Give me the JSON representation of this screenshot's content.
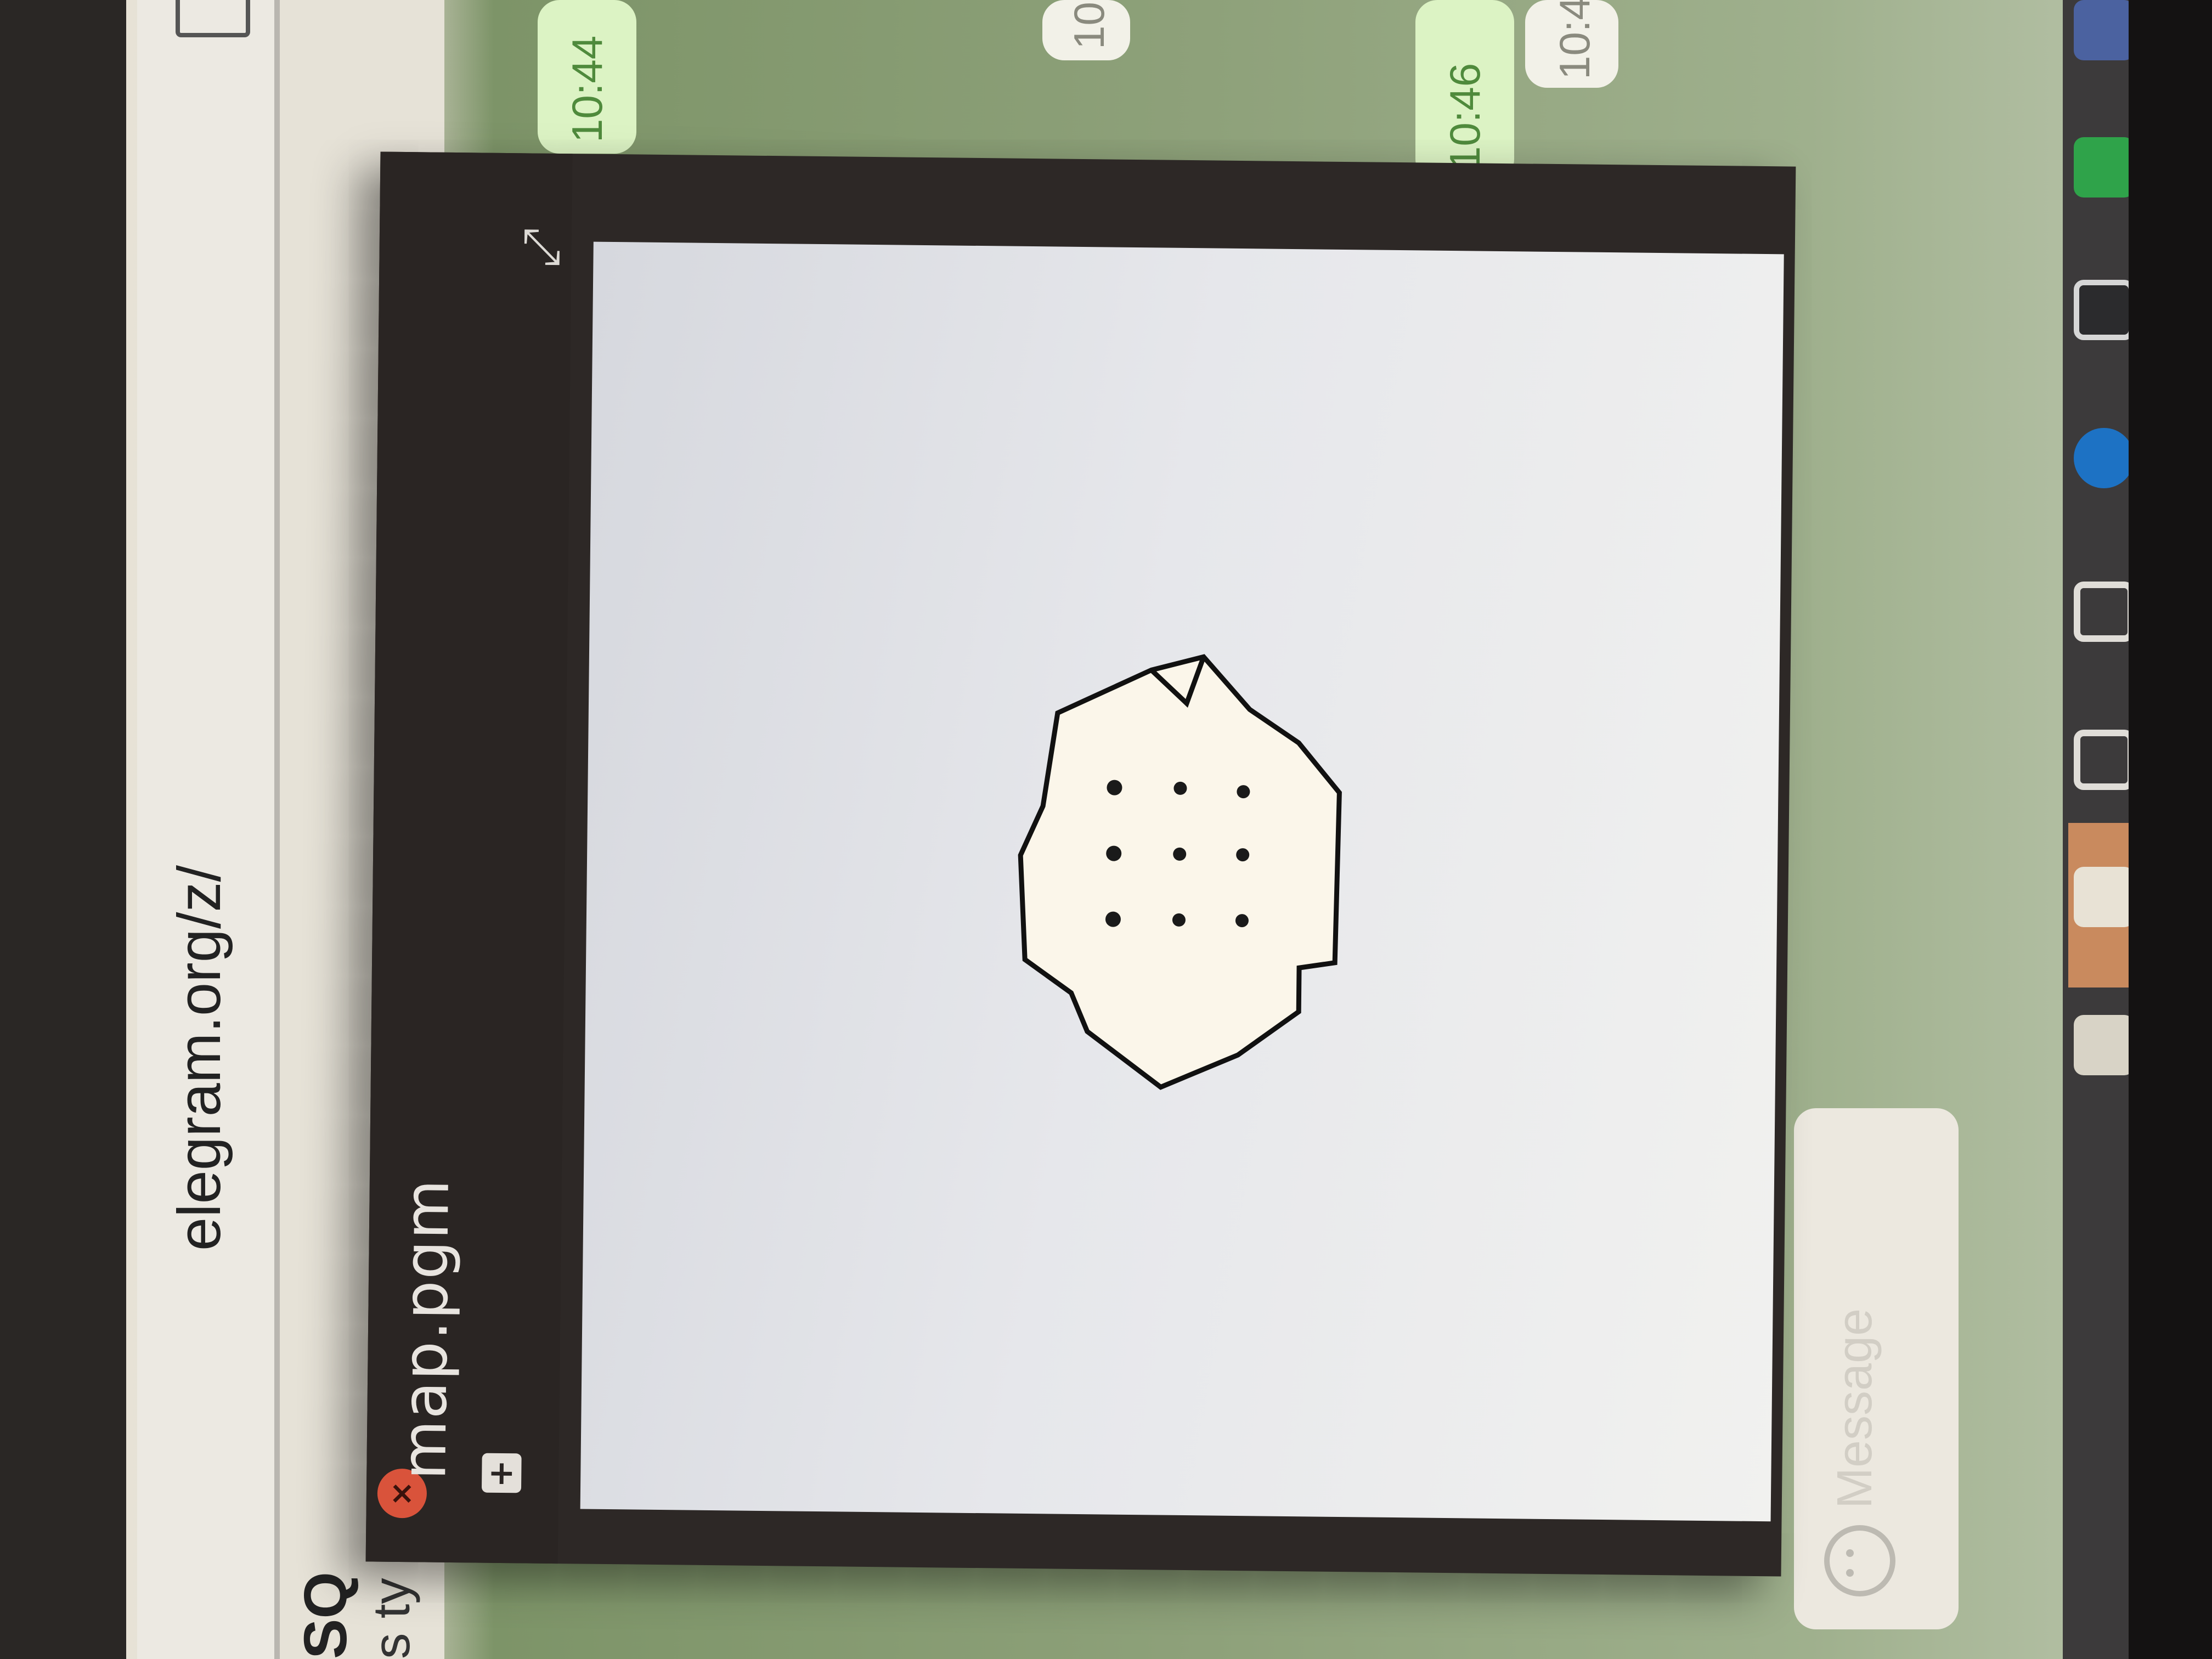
{
  "browser": {
    "address": "elegram.org/z/"
  },
  "chat": {
    "name": "SQ",
    "status": "s ty",
    "messages": [
      {
        "direction": "out",
        "time": "10:44"
      },
      {
        "direction": "out",
        "time": "10:46"
      },
      {
        "direction": "in",
        "time": "10"
      },
      {
        "direction": "in",
        "time": "10:4"
      }
    ],
    "composer_placeholder": "Message"
  },
  "viewer": {
    "title": "map.pgm",
    "close_label": "×",
    "add_label": "+",
    "fullscreen_label": "⤡"
  },
  "colors": {
    "viewer_bg": "#2d2826",
    "close_button": "#d9533b",
    "map_free_space": "#fbf6ea",
    "map_obstacle": "#111111",
    "dock_highlight": "#c98a5e"
  },
  "dock": {
    "items": [
      "file-manager-icon",
      "folder-icon",
      "package-icon",
      "package-icon",
      "teamviewer-icon",
      "vscode-icon",
      "terminal-icon",
      "facebook-icon"
    ]
  }
}
